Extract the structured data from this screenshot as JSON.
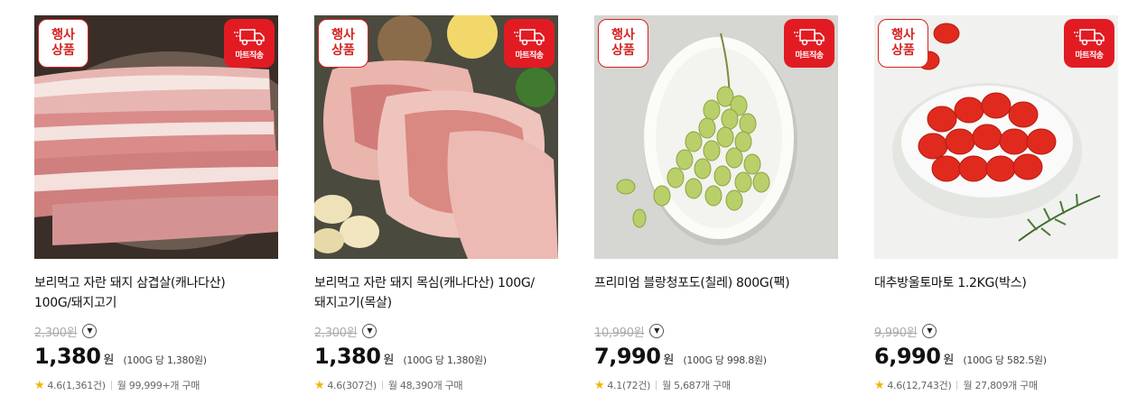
{
  "products": [
    {
      "event_badge": [
        "행사",
        "상품"
      ],
      "delivery_badge": "마트직송",
      "title_line1": "보리먹고 자란 돼지 삼겹살(캐나다산)",
      "title_line2": "100G/돼지고기",
      "original_price": "2,300원",
      "price": "1,380",
      "currency": "원",
      "unit_price": "(100G 당 1,380원)",
      "rating": "4.6",
      "reviews": "(1,361건)",
      "monthly": "월 99,999+개 구매",
      "image": "pork-belly"
    },
    {
      "event_badge": [
        "행사",
        "상품"
      ],
      "delivery_badge": "마트직송",
      "title_line1": "보리먹고 자란 돼지 목심(캐나다산) 100G/",
      "title_line2": "돼지고기(목살)",
      "original_price": "2,300원",
      "price": "1,380",
      "currency": "원",
      "unit_price": "(100G 당 1,380원)",
      "rating": "4.6",
      "reviews": "(307건)",
      "monthly": "월 48,390개 구매",
      "image": "pork-neck"
    },
    {
      "event_badge": [
        "행사",
        "상품"
      ],
      "delivery_badge": "마트직송",
      "title_line1": "프리미엄 블랑청포도(칠레) 800G(팩)",
      "title_line2": "",
      "original_price": "10,990원",
      "price": "7,990",
      "currency": "원",
      "unit_price": "(100G 당 998.8원)",
      "rating": "4.1",
      "reviews": "(72건)",
      "monthly": "월 5,687개 구매",
      "image": "green-grapes"
    },
    {
      "event_badge": [
        "행사",
        "상품"
      ],
      "delivery_badge": "마트직송",
      "title_line1": "대추방울토마토 1.2KG(박스)",
      "title_line2": "",
      "original_price": "9,990원",
      "price": "6,990",
      "currency": "원",
      "unit_price": "(100G 당 582.5원)",
      "rating": "4.6",
      "reviews": "(12,743건)",
      "monthly": "월 27,809개 구매",
      "image": "cherry-tomatoes"
    }
  ],
  "colors": {
    "accent": "#e21b23",
    "star": "#f5b300"
  },
  "icons": {
    "delivery": "delivery-truck-icon",
    "info": "chevron-down-icon",
    "rating": "star-icon"
  }
}
